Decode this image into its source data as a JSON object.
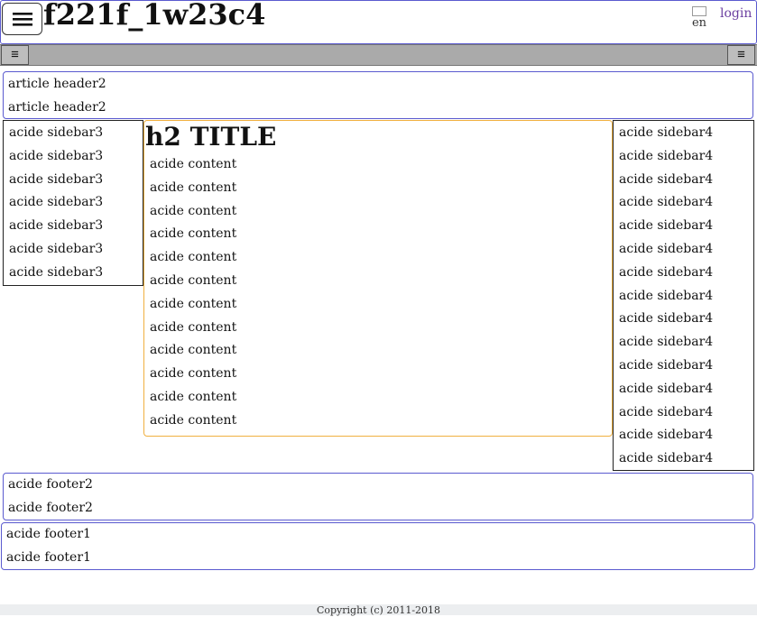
{
  "header": {
    "site_title": "f221f_1w23c4",
    "language_alt": "en",
    "login_label": "login",
    "menu_icon": "hamburger-icon"
  },
  "menu_bar": {
    "left_icon": "list-icon",
    "right_icon": "list-icon"
  },
  "article_header": {
    "lines": [
      "article header2",
      "article header2"
    ]
  },
  "sidebar3": {
    "items": [
      "acide sidebar3",
      "acide sidebar3",
      "acide sidebar3",
      "acide sidebar3",
      "acide sidebar3",
      "acide sidebar3",
      "acide sidebar3"
    ]
  },
  "content": {
    "title": "h2 TITLE",
    "lines": [
      "acide content",
      "acide content",
      "acide content",
      "acide content",
      "acide content",
      "acide content",
      "acide content",
      "acide content",
      "acide content",
      "acide content",
      "acide content",
      "acide content"
    ]
  },
  "sidebar4": {
    "items": [
      "acide sidebar4",
      "acide sidebar4",
      "acide sidebar4",
      "acide sidebar4",
      "acide sidebar4",
      "acide sidebar4",
      "acide sidebar4",
      "acide sidebar4",
      "acide sidebar4",
      "acide sidebar4",
      "acide sidebar4",
      "acide sidebar4",
      "acide sidebar4",
      "acide sidebar4",
      "acide sidebar4"
    ]
  },
  "footer2": {
    "lines": [
      "acide footer2",
      "acide footer2"
    ]
  },
  "footer1": {
    "lines": [
      "acide footer1",
      "acide footer1"
    ]
  },
  "copyright": "Copyright (c) 2011-2018"
}
